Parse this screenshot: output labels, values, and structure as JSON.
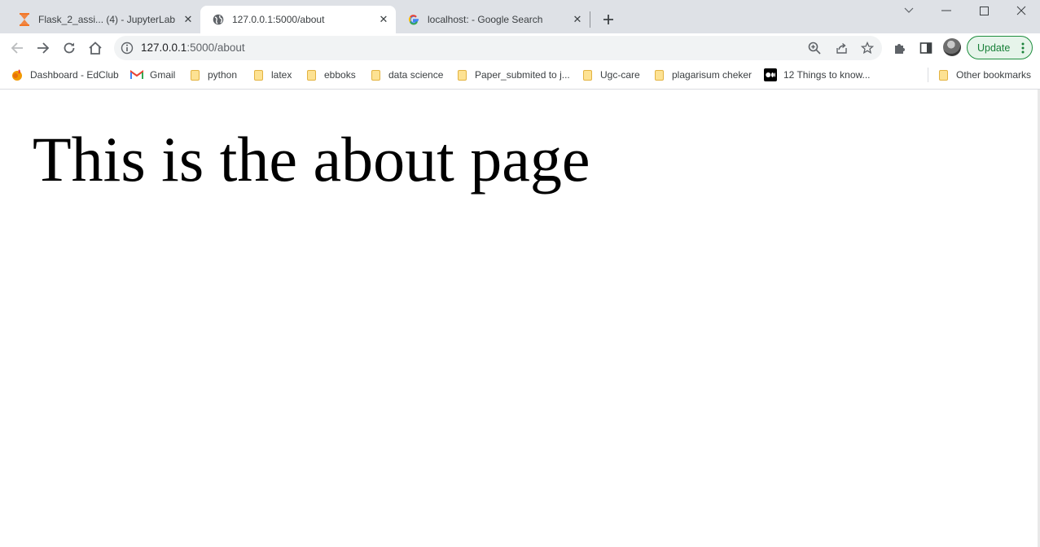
{
  "colors": {
    "tabstrip_bg": "#dee1e6",
    "update_accent": "#188038",
    "folder": "#fde293"
  },
  "tabs": [
    {
      "title": "Flask_2_assi... (4) - JupyterLab",
      "icon": "jupyter-hourglass-icon",
      "active": false
    },
    {
      "title": "127.0.0.1:5000/about",
      "icon": "globe-icon",
      "active": true
    },
    {
      "title": "localhost: - Google Search",
      "icon": "google-g-icon",
      "active": false
    }
  ],
  "toolbar": {
    "url_host": "127.0.0.1",
    "url_path": ":5000/about",
    "update_label": "Update"
  },
  "bookmarks": [
    {
      "label": "Dashboard - EdClub",
      "icon": "edclub-icon"
    },
    {
      "label": "Gmail",
      "icon": "gmail-icon"
    },
    {
      "label": "python",
      "icon": "folder-icon"
    },
    {
      "label": "latex",
      "icon": "folder-icon"
    },
    {
      "label": "ebboks",
      "icon": "folder-icon"
    },
    {
      "label": "data science",
      "icon": "folder-icon"
    },
    {
      "label": "Paper_submited to j...",
      "icon": "folder-icon"
    },
    {
      "label": "Ugc-care",
      "icon": "folder-icon"
    },
    {
      "label": "plagarisum cheker",
      "icon": "folder-icon"
    },
    {
      "label": "12 Things to know...",
      "icon": "medium-icon"
    },
    {
      "label": "Other bookmarks",
      "icon": "folder-icon"
    }
  ],
  "page": {
    "heading": "This is the about page"
  }
}
